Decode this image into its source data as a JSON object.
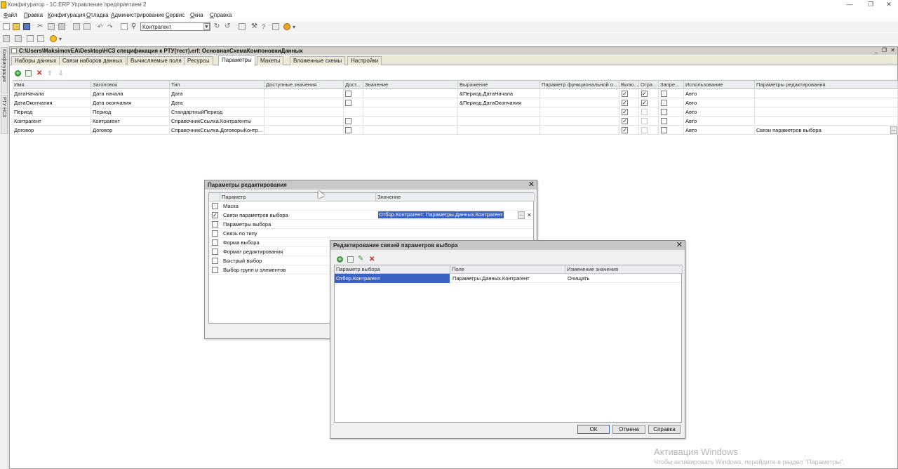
{
  "window": {
    "title": "Конфигуратор - 1С:ERP Управление предприятием 2",
    "controls": [
      "—",
      "❐",
      "✕"
    ]
  },
  "menu": [
    "Файл",
    "Правка",
    "Конфигурация",
    "Отладка",
    "Администрирование",
    "Сервис",
    "Окна",
    "Справка"
  ],
  "toolbar": {
    "search_value": "Контрагент"
  },
  "side_panel": {
    "tabs": [
      "Конфигурация",
      "РТУ НСЗ"
    ]
  },
  "document": {
    "title": "C:\\Users\\MaksimovEA\\Desktop\\НСЗ спецификация к РТУ(тест).erf: ОсновнаяСхемаКомпоновкиДанных",
    "controls": [
      "_",
      "❐",
      "✕"
    ],
    "tabs": [
      "Наборы данных",
      "Связи наборов данных",
      "Вычисляемые поля",
      "Ресурсы",
      "Параметры",
      "Макеты",
      "Вложенные схемы",
      "Настройки"
    ],
    "active_tab": "Параметры"
  },
  "params_grid": {
    "columns": [
      "Имя",
      "Заголовок",
      "Тип",
      "Доступные значения",
      "Дост...",
      "Значение",
      "Выражение",
      "Параметр функциональной о...",
      "Вклю...",
      "Огра...",
      "Запре...",
      "Использование",
      "Параметры редактирования"
    ],
    "rows": [
      {
        "name": "ДатаНачала",
        "title": "Дата начала",
        "type": "Дата",
        "avail": "",
        "avail_cb": false,
        "value": "",
        "expr": "&Период.ДатаНачала",
        "func": "",
        "incl": true,
        "restr": true,
        "restr_enabled": true,
        "forbid": false,
        "usage": "Авто",
        "edit": ""
      },
      {
        "name": "ДатаОкончания",
        "title": "Дата окончания",
        "type": "Дата",
        "avail": "",
        "avail_cb": false,
        "value": "",
        "expr": "&Период.ДатаОкончания",
        "func": "",
        "incl": true,
        "restr": true,
        "restr_enabled": true,
        "forbid": false,
        "usage": "Авто",
        "edit": ""
      },
      {
        "name": "Период",
        "title": "Период",
        "type": "СтандартныйПериод",
        "avail": "",
        "avail_cb": null,
        "value": "",
        "expr": "",
        "func": "",
        "incl": true,
        "restr": false,
        "restr_enabled": false,
        "forbid": false,
        "usage": "Авто",
        "edit": ""
      },
      {
        "name": "Контрагент",
        "title": "Контрагент",
        "type": "СправочникСсылка.Контрагенты",
        "avail": "",
        "avail_cb": false,
        "value": "",
        "expr": "",
        "func": "",
        "incl": true,
        "restr": false,
        "restr_enabled": false,
        "forbid": false,
        "usage": "Авто",
        "edit": ""
      },
      {
        "name": "Договор",
        "title": "Договор",
        "type": "СправочникСсылка.ДоговорыКонтр...",
        "avail": "",
        "avail_cb": false,
        "value": "",
        "expr": "",
        "func": "",
        "incl": true,
        "restr": false,
        "restr_enabled": false,
        "forbid": false,
        "usage": "Авто",
        "edit": "Связи параметров выбора"
      }
    ]
  },
  "edit_params_dialog": {
    "title": "Параметры редактирования",
    "columns": [
      "Параметр",
      "Значение"
    ],
    "rows": [
      {
        "checked": false,
        "param": "Маска",
        "value": ""
      },
      {
        "checked": true,
        "param": "Связи параметров выбора",
        "value": "Отбор.Контрагент: Параметры.Данных.Контрагент"
      },
      {
        "checked": false,
        "param": "Параметры выбора",
        "value": ""
      },
      {
        "checked": false,
        "param": "Связь по типу",
        "value": ""
      },
      {
        "checked": false,
        "param": "Форма выбора",
        "value": ""
      },
      {
        "checked": false,
        "param": "Формат редактирования",
        "value": ""
      },
      {
        "checked": false,
        "param": "Быстрый выбор",
        "value": ""
      },
      {
        "checked": false,
        "param": "Выбор групп и элементов",
        "value": ""
      }
    ]
  },
  "links_dialog": {
    "title": "Редактирование связей параметров выбора",
    "columns": [
      "Параметр выбора",
      "Поле",
      "Изменение значения"
    ],
    "rows": [
      {
        "param": "Отбор.Контрагент",
        "field": "Параметры.Данных.Контрагент",
        "change": "Очищать"
      }
    ],
    "buttons": {
      "ok": "ОК",
      "cancel": "Отмена",
      "help": "Справка"
    }
  },
  "watermark": {
    "title": "Активация Windows",
    "subtitle": "Чтобы активировать Windows, перейдите в раздел \"Параметры\"."
  }
}
